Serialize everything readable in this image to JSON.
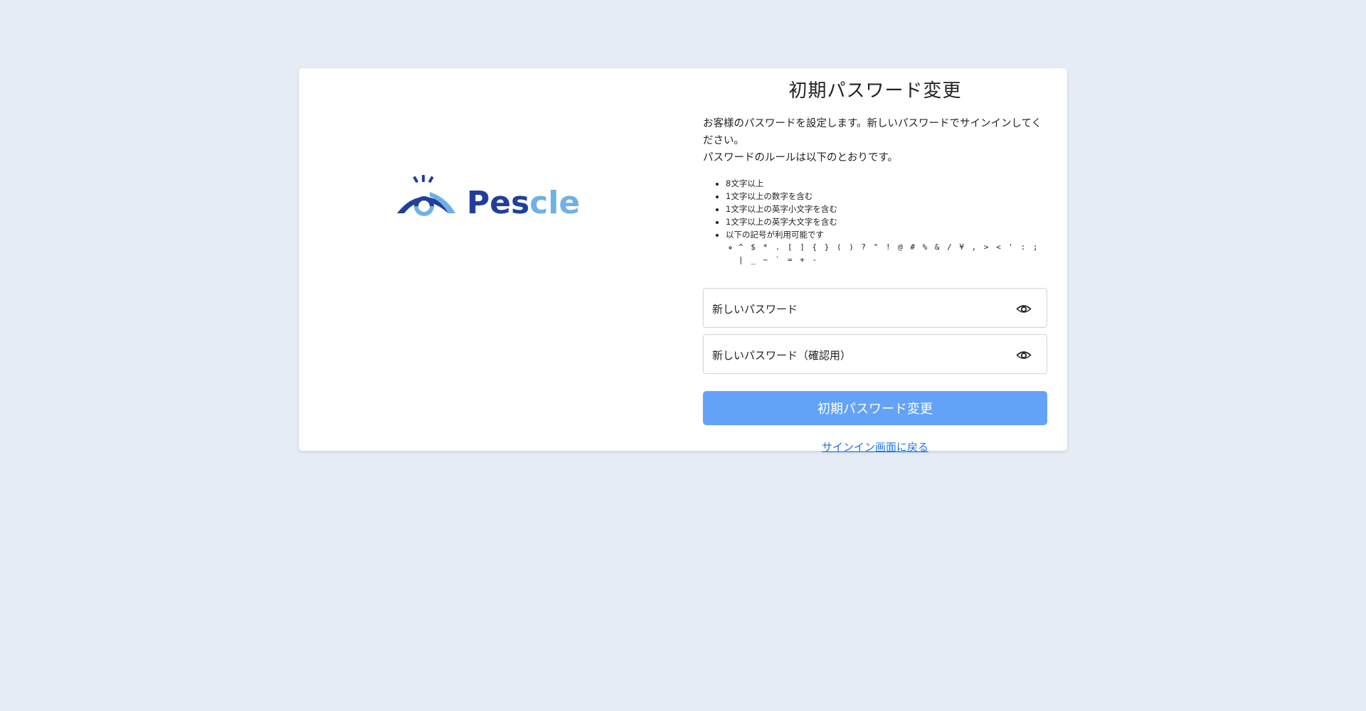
{
  "logo": {
    "text_dark": "Pes",
    "text_light": "cle",
    "color_dark": "#213f9a",
    "color_light": "#6fb0e8"
  },
  "form": {
    "title": "初期パスワード変更",
    "description_line1": "お客様のパスワードを設定します。新しいパスワードでサインインしてください。",
    "description_line2": "パスワードのルールは以下のとおりです。",
    "rules": [
      "8文字以上",
      "1文字以上の数字を含む",
      "1文字以上の英字小文字を含む",
      "1文字以上の英字大文字を含む",
      "以下の記号が利用可能です"
    ],
    "symbols": "^ $ * . [ ] { } ( ) ? \" ! @ # % & / ¥ , > < ' : ; | _ ~ ` = + -",
    "new_password_label": "新しいパスワード",
    "confirm_password_label": "新しいパスワード（確認用）",
    "submit_label": "初期パスワード変更",
    "back_link": "サインイン画面に戻る"
  },
  "icons": {
    "password_visibility": "eye-icon"
  },
  "colors": {
    "background": "#e6edf6",
    "button": "#63a3f7",
    "link": "#1a73e8"
  }
}
